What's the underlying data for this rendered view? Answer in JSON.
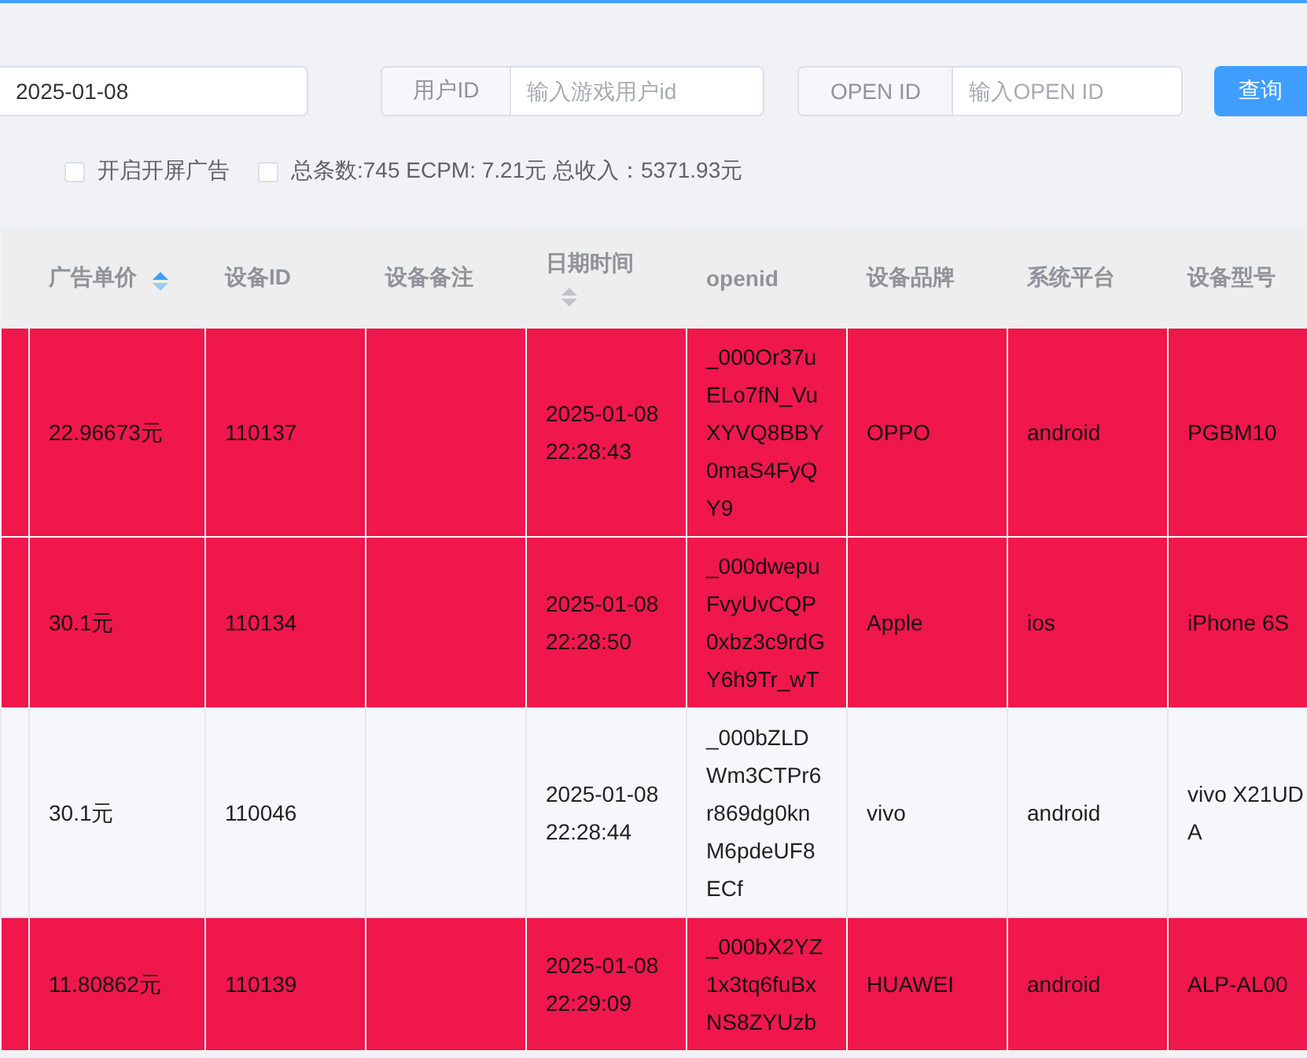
{
  "filters": {
    "date": {
      "value": "2025-01-08"
    },
    "user_id": {
      "label": "用户ID",
      "placeholder": "输入游戏用户id"
    },
    "open_id": {
      "label": "OPEN ID",
      "placeholder": "输入OPEN ID"
    },
    "query_button": "查询"
  },
  "options": [
    {
      "label": "开启开屏广告",
      "checked": false
    },
    {
      "label": "总条数:745 ECPM: 7.21元 总收入：5371.93元",
      "checked": false
    }
  ],
  "table": {
    "columns": [
      {
        "label": "广告单价",
        "sortable": true,
        "sort_active": true
      },
      {
        "label": "设备ID",
        "sortable": false
      },
      {
        "label": "设备备注",
        "sortable": false
      },
      {
        "label": "日期时间",
        "sortable": true,
        "sort_active": false
      },
      {
        "label": "openid",
        "sortable": false
      },
      {
        "label": "设备品牌",
        "sortable": false
      },
      {
        "label": "系统平台",
        "sortable": false
      },
      {
        "label": "设备型号",
        "sortable": false
      }
    ],
    "rows": [
      {
        "highlighted": true,
        "cells": [
          "22.96673元",
          "110137",
          "",
          [
            "2025-01-08",
            "22:28:43"
          ],
          [
            "_000Or37u",
            "ELo7fN_Vu",
            "XYVQ8BBY",
            "0maS4FyQ",
            "Y9"
          ],
          "OPPO",
          "android",
          [
            "PGBM10"
          ]
        ]
      },
      {
        "highlighted": true,
        "cells": [
          "30.1元",
          "110134",
          "",
          [
            "2025-01-08",
            "22:28:50"
          ],
          [
            "_000dwepu",
            "FvyUvCQP",
            "0xbz3c9rdG",
            "Y6h9Tr_wT"
          ],
          "Apple",
          "ios",
          [
            "iPhone 6S"
          ]
        ]
      },
      {
        "highlighted": false,
        "cells": [
          "30.1元",
          "110046",
          "",
          [
            "2025-01-08",
            "22:28:44"
          ],
          [
            "_000bZLD",
            "Wm3CTPr6",
            "r869dg0kn",
            "M6pdeUF8",
            "ECf"
          ],
          "vivo",
          "android",
          [
            "vivo X21UD",
            "A"
          ]
        ]
      },
      {
        "highlighted": true,
        "cells": [
          "11.80862元",
          "110139",
          "",
          [
            "2025-01-08",
            "22:29:09"
          ],
          [
            "_000bX2YZ",
            "1x3tq6fuBx",
            "NS8ZYUzb"
          ],
          "HUAWEI",
          "android",
          [
            "ALP-AL00"
          ]
        ]
      }
    ]
  }
}
